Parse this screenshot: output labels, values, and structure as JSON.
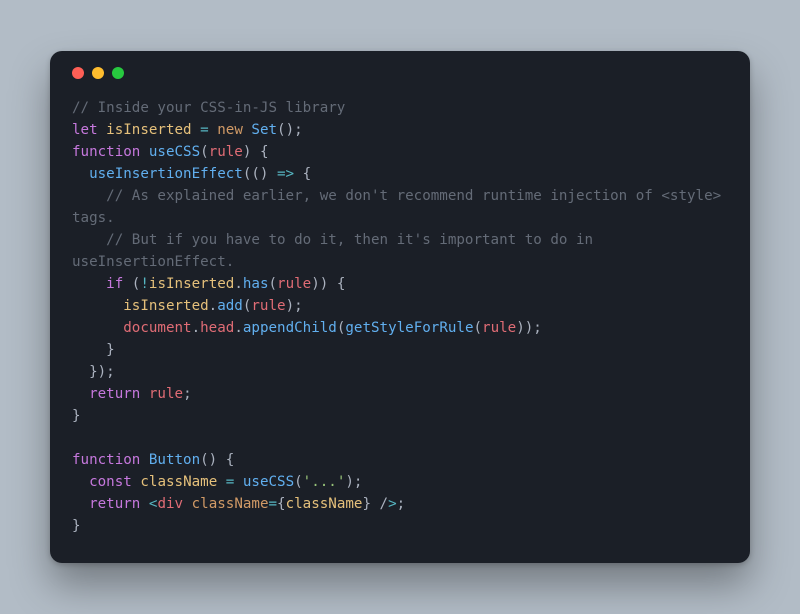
{
  "traffic_lights": {
    "close_color": "#ff5f56",
    "minimize_color": "#ffbd2e",
    "zoom_color": "#27c93f"
  },
  "code": {
    "l1": "// Inside your CSS-in-JS library",
    "l2a": "let",
    "l2b": "isInserted",
    "l2c": "=",
    "l2d": "new",
    "l2e": "Set",
    "l2f": "();",
    "l3a": "function",
    "l3b": "useCSS",
    "l3c": "(",
    "l3d": "rule",
    "l3e": ") {",
    "l4a": "useInsertionEffect",
    "l4b": "(() ",
    "l4c": "=>",
    "l4d": " {",
    "l5": "// As explained earlier, we don't recommend runtime injection of <style> tags.",
    "l6": "// But if you have to do it, then it's important to do in useInsertionEffect.",
    "l7a": "if",
    "l7b": " (",
    "l7c": "!",
    "l7d": "isInserted",
    "l7e": ".",
    "l7f": "has",
    "l7g": "(",
    "l7h": "rule",
    "l7i": ")) {",
    "l8a": "isInserted",
    "l8b": ".",
    "l8c": "add",
    "l8d": "(",
    "l8e": "rule",
    "l8f": ");",
    "l9a": "document",
    "l9b": ".",
    "l9c": "head",
    "l9d": ".",
    "l9e": "appendChild",
    "l9f": "(",
    "l9g": "getStyleForRule",
    "l9h": "(",
    "l9i": "rule",
    "l9j": "));",
    "l10": "}",
    "l11": "});",
    "l12a": "return",
    "l12b": "rule",
    "l12c": ";",
    "l13": "}",
    "l14": "",
    "l15a": "function",
    "l15b": "Button",
    "l15c": "() {",
    "l16a": "const",
    "l16b": "className",
    "l16c": "=",
    "l16d": "useCSS",
    "l16e": "(",
    "l16f": "'...'",
    "l16g": ");",
    "l17a": "return",
    "l17b": "<",
    "l17c": "div",
    "l17d": "className",
    "l17e": "=",
    "l17f": "{",
    "l17g": "className",
    "l17h": "}",
    "l17i": " /",
    "l17j": ">",
    "l17k": ";",
    "l18": "}"
  }
}
